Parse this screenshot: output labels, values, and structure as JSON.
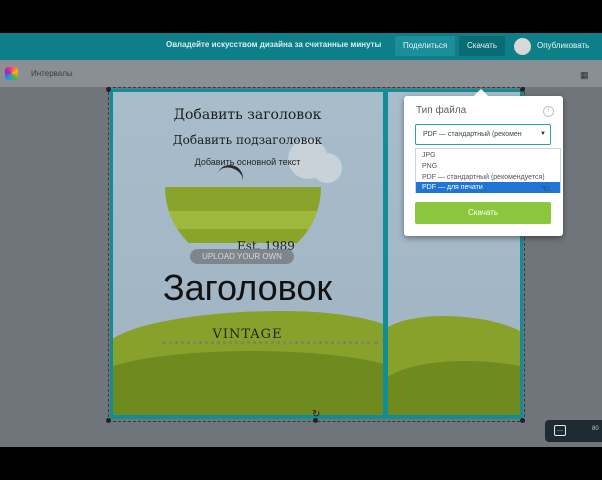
{
  "header": {
    "promo_text": "Овладейте искусством дизайна за считанные минуты",
    "share_label": "Поделиться",
    "download_label": "Скачать",
    "publish_label": "Опубликовать"
  },
  "toolbar": {
    "intervals_label": "Интервалы"
  },
  "design": {
    "heading": "Добавить заголовок",
    "subheading": "Добавить подзаголовок",
    "body_text": "Добавить основной текст",
    "est_text": "Est. 1989",
    "upload_label": "UPLOAD YOUR OWN",
    "big_title": "Заголовок",
    "vintage_text": "VINTAGE"
  },
  "download_popup": {
    "title": "Тип файла",
    "selected_value": "PDF — стандартный (рекомен",
    "options": [
      "JPG",
      "PNG",
      "PDF — стандартный (рекомендуется)",
      "PDF — для печати"
    ],
    "highlighted_index": 3,
    "download_button_label": "Скачать"
  },
  "chat_widget": {
    "partial_text": "80"
  },
  "colors": {
    "brand_teal": "#0e7f89",
    "download_green": "#8cc63e",
    "selection_blue": "#1f74d4"
  }
}
